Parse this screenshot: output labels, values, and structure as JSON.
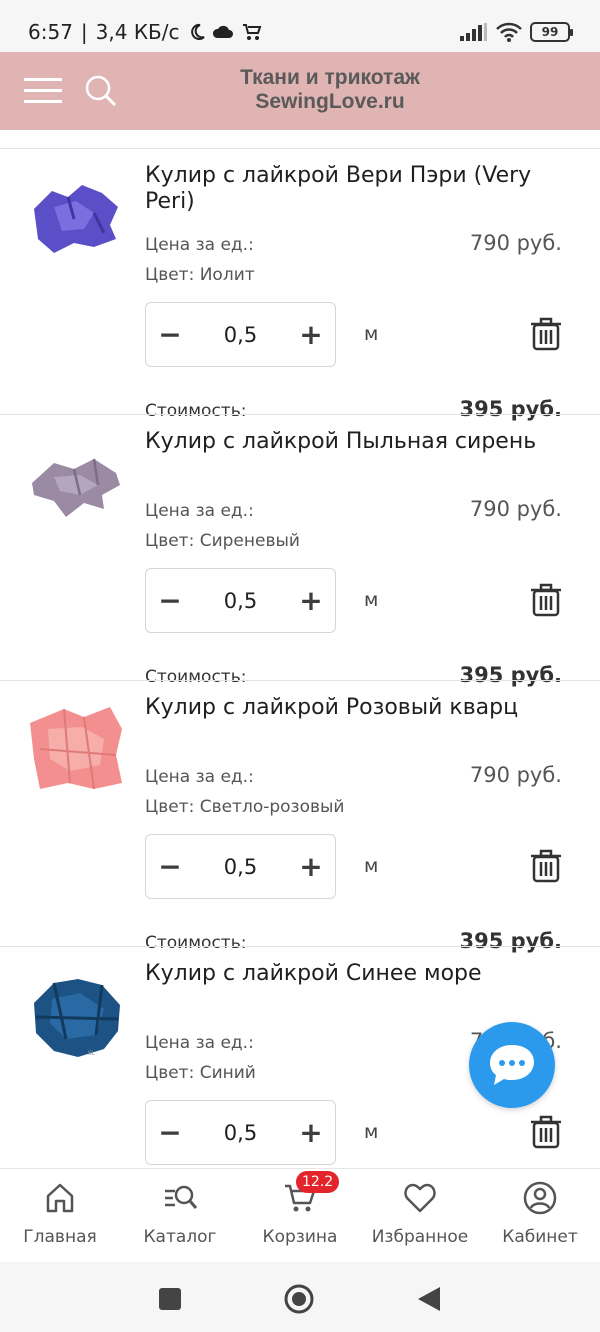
{
  "status_bar": {
    "time": "6:57",
    "speed": "3,4 КБ/с",
    "battery": "99"
  },
  "header": {
    "brand_line1": "Ткани и трикотаж",
    "brand_line2": "SewingLove.ru"
  },
  "labels": {
    "price_per_unit": "Цена за ед.:",
    "cost": "Стоимость:",
    "unit": "м",
    "minus": "−",
    "plus": "+"
  },
  "items": [
    {
      "title": "Кулир с лайкрой Вери Пэри (Very Peri)",
      "price": "790 руб.",
      "color": "Цвет: Иолит",
      "quantity": "0,5",
      "cost": "395 руб.",
      "swatch": "#5b4fc7"
    },
    {
      "title": "Кулир с лайкрой Пыльная сирень",
      "price": "790 руб.",
      "color": "Цвет: Сиреневый",
      "quantity": "0,5",
      "cost": "395 руб.",
      "swatch": "#9a8aa3"
    },
    {
      "title": "Кулир с лайкрой Розовый кварц",
      "price": "790 руб.",
      "color": "Цвет: Светло-розовый",
      "quantity": "0,5",
      "cost": "395 руб.",
      "swatch": "#f3908f"
    },
    {
      "title": "Кулир с лайкрой Синее море",
      "price": "790 руб.",
      "color": "Цвет: Синий",
      "quantity": "0,5",
      "cost": "",
      "swatch": "#1c5384"
    }
  ],
  "bottom_nav": {
    "home": "Главная",
    "catalog": "Каталог",
    "cart": "Корзина",
    "cart_badge": "12.2",
    "favorites": "Избранное",
    "account": "Кабинет"
  },
  "colors": {
    "header_bg": "#e0b4b2",
    "brand_text": "#5a5a5a",
    "chat_fab": "#2b9aed",
    "badge": "#e3242b"
  }
}
